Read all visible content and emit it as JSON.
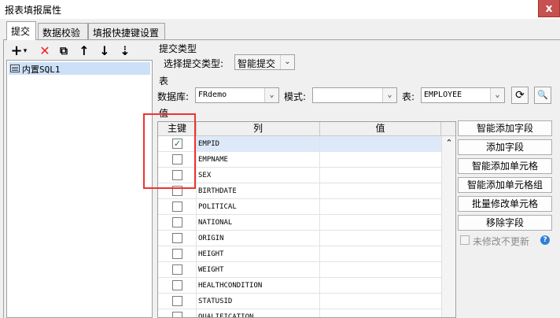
{
  "window": {
    "title": "报表填报属性",
    "close_label": "x"
  },
  "tabs": [
    "提交",
    "数据校验",
    "填报快捷键设置"
  ],
  "left_toolbar": {
    "add": "+",
    "add_caret": "▾",
    "delete": "✕",
    "copy": "⧉",
    "up": "↑",
    "down": "↓",
    "sort": "⇣"
  },
  "tree": {
    "item": "内置SQL1"
  },
  "submit": {
    "section_label": "提交类型",
    "type_label": "选择提交类型:",
    "type_value": "智能提交"
  },
  "table_section": {
    "label": "表",
    "db_label": "数据库:",
    "db_value": "FRdemo",
    "mode_label": "模式:",
    "mode_value": "",
    "table_label": "表:",
    "table_value": "EMPLOYEE",
    "refresh_icon": "⟳",
    "preview_icon": "🔍"
  },
  "values_section": {
    "label": "值"
  },
  "grid": {
    "headers": {
      "key": "主键",
      "column": "列",
      "value": "值"
    },
    "rows": [
      {
        "key": true,
        "column": "EMPID",
        "value": ""
      },
      {
        "key": false,
        "column": "EMPNAME",
        "value": ""
      },
      {
        "key": false,
        "column": "SEX",
        "value": ""
      },
      {
        "key": false,
        "column": "BIRTHDATE",
        "value": ""
      },
      {
        "key": false,
        "column": "POLITICAL",
        "value": ""
      },
      {
        "key": false,
        "column": "NATIONAL",
        "value": ""
      },
      {
        "key": false,
        "column": "ORIGIN",
        "value": ""
      },
      {
        "key": false,
        "column": "HEIGHT",
        "value": ""
      },
      {
        "key": false,
        "column": "WEIGHT",
        "value": ""
      },
      {
        "key": false,
        "column": "HEALTHCONDITION",
        "value": ""
      },
      {
        "key": false,
        "column": "STATUSID",
        "value": ""
      },
      {
        "key": false,
        "column": "QUALIFICATION",
        "value": ""
      }
    ],
    "scroll_up": "⌃"
  },
  "right_buttons": [
    "智能添加字段",
    "添加字段",
    "智能添加单元格",
    "智能添加单元格组",
    "批量修改单元格",
    "移除字段"
  ],
  "no_update_option": {
    "label": "未修改不更新",
    "checked": false,
    "help": "?"
  },
  "colors": {
    "highlight_box": "#e33333",
    "selection": "#cce0f7",
    "check": "#1b7a2b"
  }
}
